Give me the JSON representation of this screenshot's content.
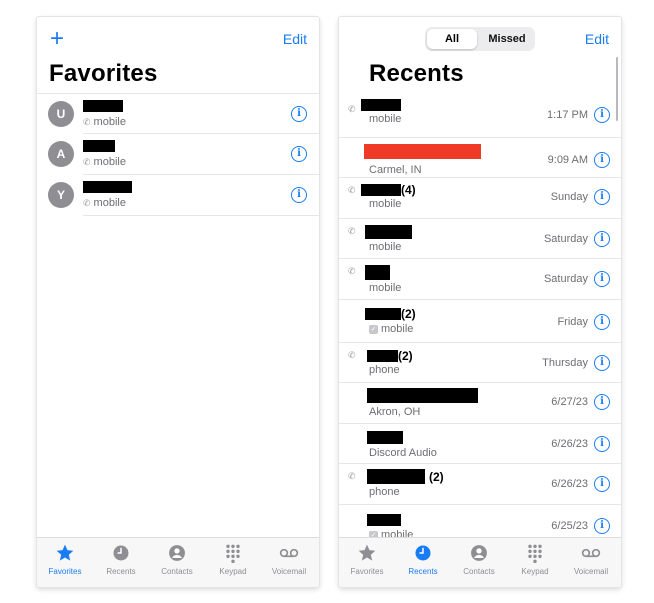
{
  "left_screen": {
    "add_label": "+",
    "edit_label": "Edit",
    "title": "Favorites",
    "favorites": [
      {
        "initial": "U",
        "sub": "mobile"
      },
      {
        "initial": "A",
        "sub": "mobile"
      },
      {
        "initial": "Y",
        "sub": "mobile"
      }
    ]
  },
  "right_screen": {
    "segments": {
      "all": "All",
      "missed": "Missed"
    },
    "edit_label": "Edit",
    "title": "Recents",
    "recents": [
      {
        "count": "",
        "sub": "mobile",
        "time": "1:17 PM"
      },
      {
        "count": "",
        "sub": "Carmel, IN",
        "time": "9:09 AM"
      },
      {
        "count": "(4)",
        "sub": "mobile",
        "time": "Sunday"
      },
      {
        "count": "",
        "sub": "mobile",
        "time": "Saturday"
      },
      {
        "count": "",
        "sub": "mobile",
        "time": "Saturday"
      },
      {
        "count": "(2)",
        "sub": "mobile",
        "time": "Friday"
      },
      {
        "count": "(2)",
        "sub": "phone",
        "time": "Thursday"
      },
      {
        "count": "",
        "sub": "Akron, OH",
        "time": "6/27/23"
      },
      {
        "count": "",
        "sub": "Discord Audio",
        "time": "6/26/23"
      },
      {
        "count": "(2)",
        "sub": "phone",
        "time": "6/26/23"
      },
      {
        "count": "",
        "sub": "mobile",
        "time": "6/25/23"
      }
    ]
  },
  "tabs": [
    {
      "label": "Favorites",
      "icon": "star-icon"
    },
    {
      "label": "Recents",
      "icon": "clock-icon"
    },
    {
      "label": "Contacts",
      "icon": "person-circle-icon"
    },
    {
      "label": "Keypad",
      "icon": "keypad-icon"
    },
    {
      "label": "Voicemail",
      "icon": "voicemail-icon"
    }
  ],
  "colors": {
    "accent": "#1a7cf5",
    "missed_redaction": "#ef3a28",
    "inactive": "#8e8e93"
  }
}
